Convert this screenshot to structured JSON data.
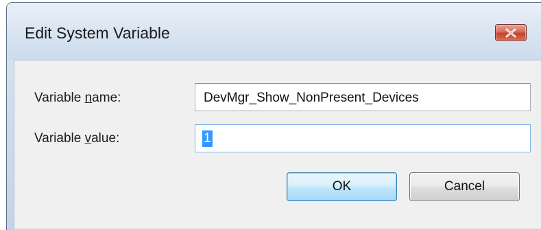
{
  "dialog": {
    "title": "Edit System Variable",
    "close_icon": "close-x-icon"
  },
  "fields": {
    "name": {
      "label_before": "Variable ",
      "label_accel": "n",
      "label_after": "ame:",
      "value": "DevMgr_Show_NonPresent_Devices"
    },
    "value": {
      "label_before": "Variable ",
      "label_accel": "v",
      "label_after": "alue:",
      "value": "1"
    }
  },
  "buttons": {
    "ok_label": "OK",
    "cancel_label": "Cancel"
  },
  "colors": {
    "selection": "#3399ff",
    "close_button": "#c4402a",
    "default_button_border": "#3c7fb1"
  }
}
